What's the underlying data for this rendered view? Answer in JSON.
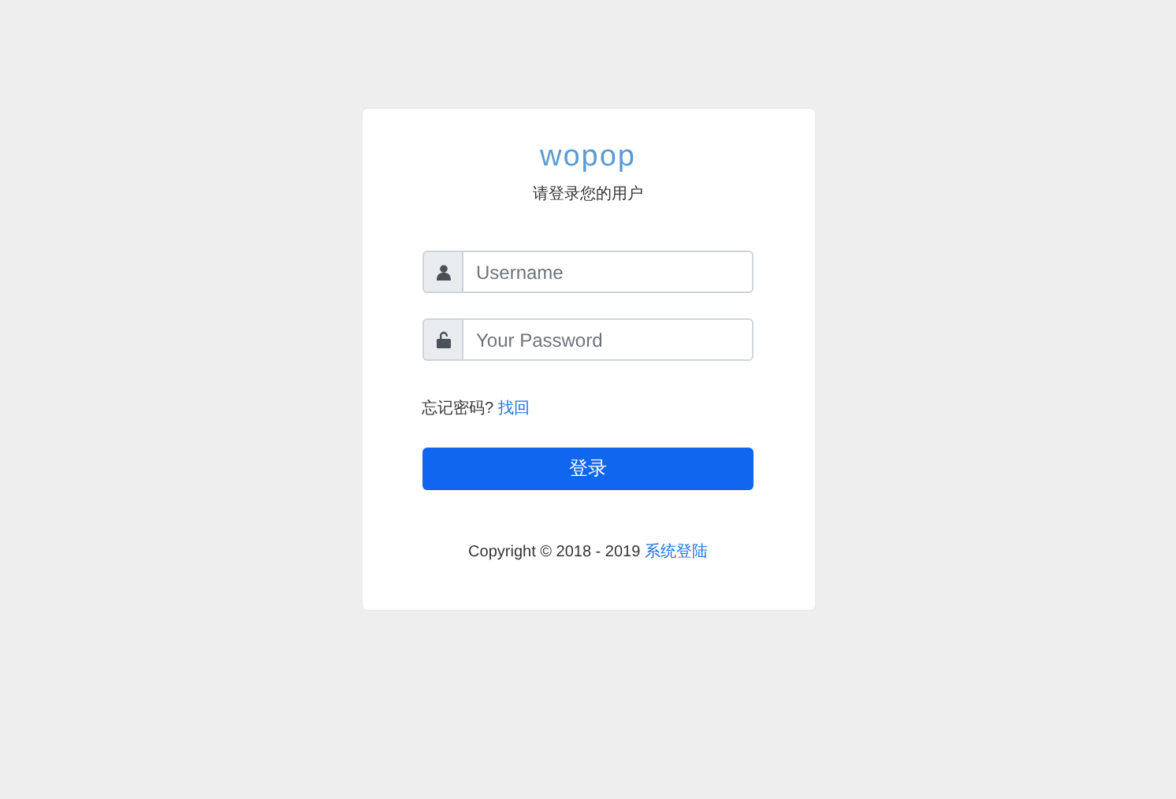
{
  "logo": "wopop",
  "subtitle": "请登录您的用户",
  "fields": [
    {
      "kind": "user",
      "placeholder": "Username"
    },
    {
      "kind": "lock",
      "placeholder": "Your Password"
    }
  ],
  "forgot": {
    "text": "忘记密码?",
    "link": "找回"
  },
  "login_button": "登录",
  "footer": {
    "text": "Copyright © 2018 - 2019",
    "link": "系统登陆"
  }
}
